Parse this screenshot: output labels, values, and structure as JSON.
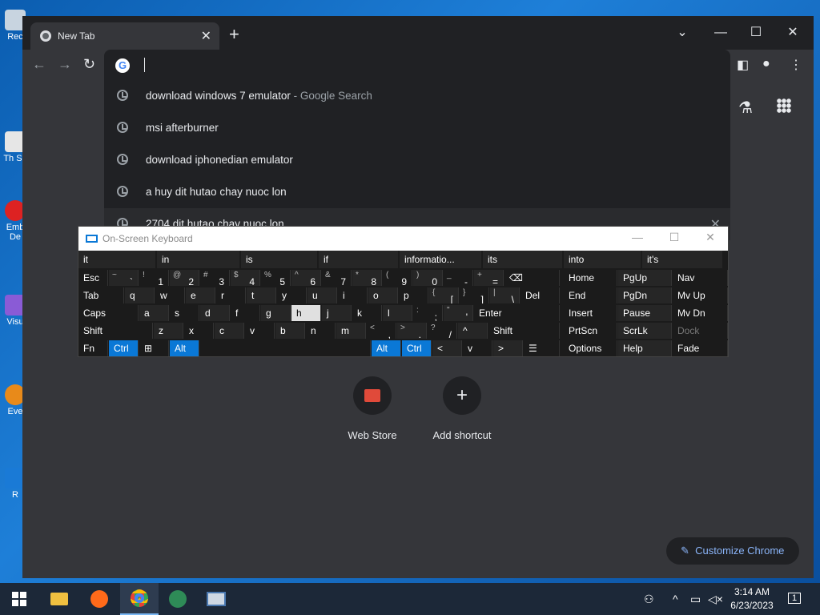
{
  "desktop": {
    "icons": [
      {
        "label": "Rec"
      },
      {
        "label": "Th Sh"
      },
      {
        "label": "Emb De"
      },
      {
        "label": "Visu"
      },
      {
        "label": "Eve"
      },
      {
        "label": "R"
      }
    ]
  },
  "browser": {
    "tab": {
      "title": "New Tab"
    },
    "new_tab_symbol": "+",
    "omnibox": {
      "value": "",
      "suggestions": [
        {
          "text": "download windows 7 emulator",
          "hint": "- Google Search"
        },
        {
          "text": "msi afterburner",
          "hint": ""
        },
        {
          "text": "download iphonedian emulator",
          "hint": ""
        },
        {
          "text": "a huy dit hutao chay nuoc lon",
          "hint": ""
        },
        {
          "text": "2704 dit hutao chay nuoc lon",
          "hint": ""
        }
      ]
    },
    "shortcuts": [
      {
        "label": "Web Store",
        "icon": "web-store-icon"
      },
      {
        "label": "Add shortcut",
        "icon": "plus-icon"
      }
    ],
    "customize_label": "Customize Chrome"
  },
  "osk": {
    "title": "On-Screen Keyboard",
    "predictions": [
      "it",
      "in",
      "is",
      "if",
      "informatio...",
      "its",
      "into",
      "it's"
    ],
    "row1": [
      {
        "main": "Esc"
      },
      {
        "shift": "~",
        "main": "`"
      },
      {
        "shift": "!",
        "main": "1"
      },
      {
        "shift": "@",
        "main": "2"
      },
      {
        "shift": "#",
        "main": "3"
      },
      {
        "shift": "$",
        "main": "4"
      },
      {
        "shift": "%",
        "main": "5"
      },
      {
        "shift": "^",
        "main": "6"
      },
      {
        "shift": "&",
        "main": "7"
      },
      {
        "shift": "*",
        "main": "8"
      },
      {
        "shift": "(",
        "main": "9"
      },
      {
        "shift": ")",
        "main": "0"
      },
      {
        "shift": "_",
        "main": "-"
      },
      {
        "shift": "+",
        "main": "="
      },
      {
        "main": "⌫"
      }
    ],
    "row2": [
      {
        "main": "Tab"
      },
      {
        "main": "q"
      },
      {
        "main": "w"
      },
      {
        "main": "e"
      },
      {
        "main": "r"
      },
      {
        "main": "t"
      },
      {
        "main": "y"
      },
      {
        "main": "u"
      },
      {
        "main": "i"
      },
      {
        "main": "o"
      },
      {
        "main": "p"
      },
      {
        "shift": "{",
        "main": "["
      },
      {
        "shift": "}",
        "main": "]"
      },
      {
        "shift": "|",
        "main": "\\"
      },
      {
        "main": "Del"
      }
    ],
    "row3": [
      {
        "main": "Caps"
      },
      {
        "main": "a"
      },
      {
        "main": "s"
      },
      {
        "main": "d"
      },
      {
        "main": "f"
      },
      {
        "main": "g"
      },
      {
        "main": "h"
      },
      {
        "main": "j"
      },
      {
        "main": "k"
      },
      {
        "main": "l"
      },
      {
        "shift": ":",
        "main": ";"
      },
      {
        "shift": "\"",
        "main": "'"
      },
      {
        "main": "Enter"
      }
    ],
    "row4": [
      {
        "main": "Shift"
      },
      {
        "main": "z"
      },
      {
        "main": "x"
      },
      {
        "main": "c"
      },
      {
        "main": "v"
      },
      {
        "main": "b"
      },
      {
        "main": "n"
      },
      {
        "main": "m"
      },
      {
        "shift": "<",
        "main": ","
      },
      {
        "shift": ">",
        "main": "."
      },
      {
        "shift": "?",
        "main": "/"
      },
      {
        "main": "^"
      },
      {
        "main": "Shift"
      }
    ],
    "row5": [
      {
        "main": "Fn"
      },
      {
        "main": "Ctrl"
      },
      {
        "main": "⊞"
      },
      {
        "main": "Alt"
      },
      {
        "main": ""
      },
      {
        "main": "Alt"
      },
      {
        "main": "Ctrl"
      },
      {
        "main": "<"
      },
      {
        "main": "v"
      },
      {
        "main": ">"
      },
      {
        "main": "☰"
      }
    ],
    "nav": [
      [
        "Home",
        "PgUp",
        "Nav"
      ],
      [
        "End",
        "PgDn",
        "Mv Up"
      ],
      [
        "Insert",
        "Pause",
        "Mv Dn"
      ],
      [
        "PrtScn",
        "ScrLk",
        "Dock"
      ],
      [
        "Options",
        "Help",
        "Fade"
      ]
    ]
  },
  "taskbar": {
    "time": "3:14 AM",
    "date": "6/23/2023",
    "notification_count": "1"
  },
  "colors": {
    "accent": "#0a78d6",
    "chrome_bg": "#35363a",
    "omnibox_bg": "#202124",
    "link": "#8ab4f8"
  }
}
